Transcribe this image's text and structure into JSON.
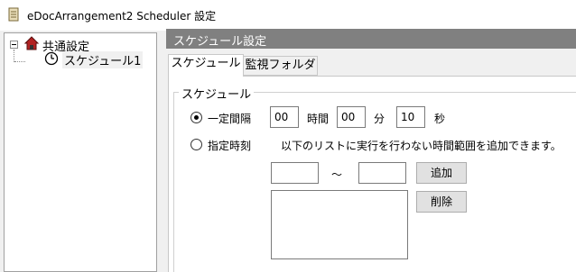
{
  "window": {
    "title": "eDocArrangement2 Scheduler 設定",
    "icon": "app-scroll-icon"
  },
  "tree": {
    "root": {
      "label": "共通設定",
      "icon": "house-icon",
      "expander": "minus"
    },
    "child": {
      "label": "スケジュール1",
      "icon": "clock-icon",
      "selected": true
    }
  },
  "panel": {
    "header": "スケジュール設定",
    "tabs": [
      {
        "label": "スケジュール",
        "active": true
      },
      {
        "label": "監視フォルダ",
        "active": false
      }
    ],
    "group_title": "スケジュール",
    "interval": {
      "radio_label": "一定間隔",
      "selected": true,
      "hours_value": "00",
      "hours_unit": "時間",
      "minutes_value": "00",
      "minutes_unit": "分",
      "seconds_value": "10",
      "seconds_unit": "秒"
    },
    "specified": {
      "radio_label": "指定時刻",
      "selected": false,
      "description": "以下のリストに実行を行わない時間範囲を追加できます。",
      "range_start": "",
      "range_separator": "～",
      "range_end": "",
      "add_button": "追加",
      "delete_button": "削除"
    }
  }
}
